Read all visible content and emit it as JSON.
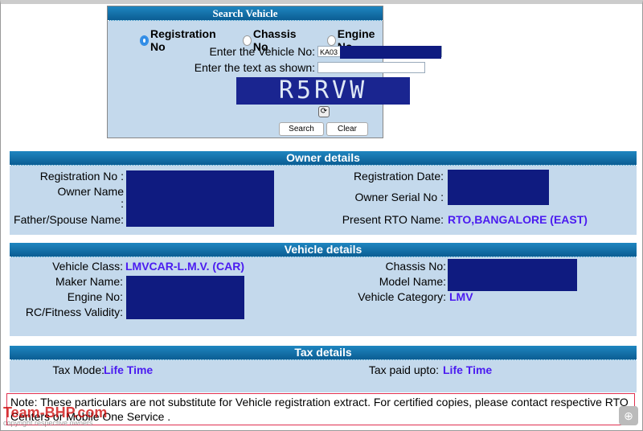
{
  "search": {
    "title": "Search Vehicle",
    "options": [
      {
        "label": "Registration No",
        "selected": true
      },
      {
        "label": "Chassis No",
        "selected": false
      },
      {
        "label": "Engine No",
        "selected": false
      }
    ],
    "vehicle_no_label": "Enter the Vehicle No:",
    "vehicle_no_value": "KA03",
    "captcha_label": "Enter the text as shown:",
    "captcha_value": "",
    "captcha_text": "R5RVW",
    "search_btn": "Search",
    "clear_btn": "Clear"
  },
  "owner": {
    "title": "Owner details",
    "reg_no_label": "Registration No :",
    "owner_name_label": "Owner Name",
    "owner_name_colon": ":",
    "father_label": "Father/Spouse Name:",
    "reg_date_label": "Registration Date:",
    "serial_label": "Owner Serial No :",
    "rto_label": "Present RTO Name:",
    "rto_value": "RTO,BANGALORE (EAST)"
  },
  "vehicle": {
    "title": "Vehicle details",
    "class_label": "Vehicle Class:",
    "class_value": "LMVCAR-L.M.V. (CAR)",
    "maker_label": "Maker Name:",
    "engine_label": "Engine No:",
    "fitness_label": "RC/Fitness Validity:",
    "chassis_label": "Chassis No:",
    "model_label": "Model Name:",
    "category_label": "Vehicle Category:",
    "category_value": "LMV"
  },
  "tax": {
    "title": "Tax details",
    "mode_label": "Tax Mode:",
    "mode_value": "Life Time",
    "upto_label": "Tax paid upto:",
    "upto_value": "Life Time"
  },
  "note": "Note: These particulars are not substitute for Vehicle registration extract. For certified copies, please contact  respective RTO Centers or Mobile One Service .",
  "watermark": {
    "brand": "Team-BHP.com",
    "copyright": "copyright respective owners"
  },
  "colors": {
    "header": "#0b5d93",
    "panel": "#c4d9ec",
    "value": "#4b1cf0",
    "redaction": "#0f1b80"
  }
}
